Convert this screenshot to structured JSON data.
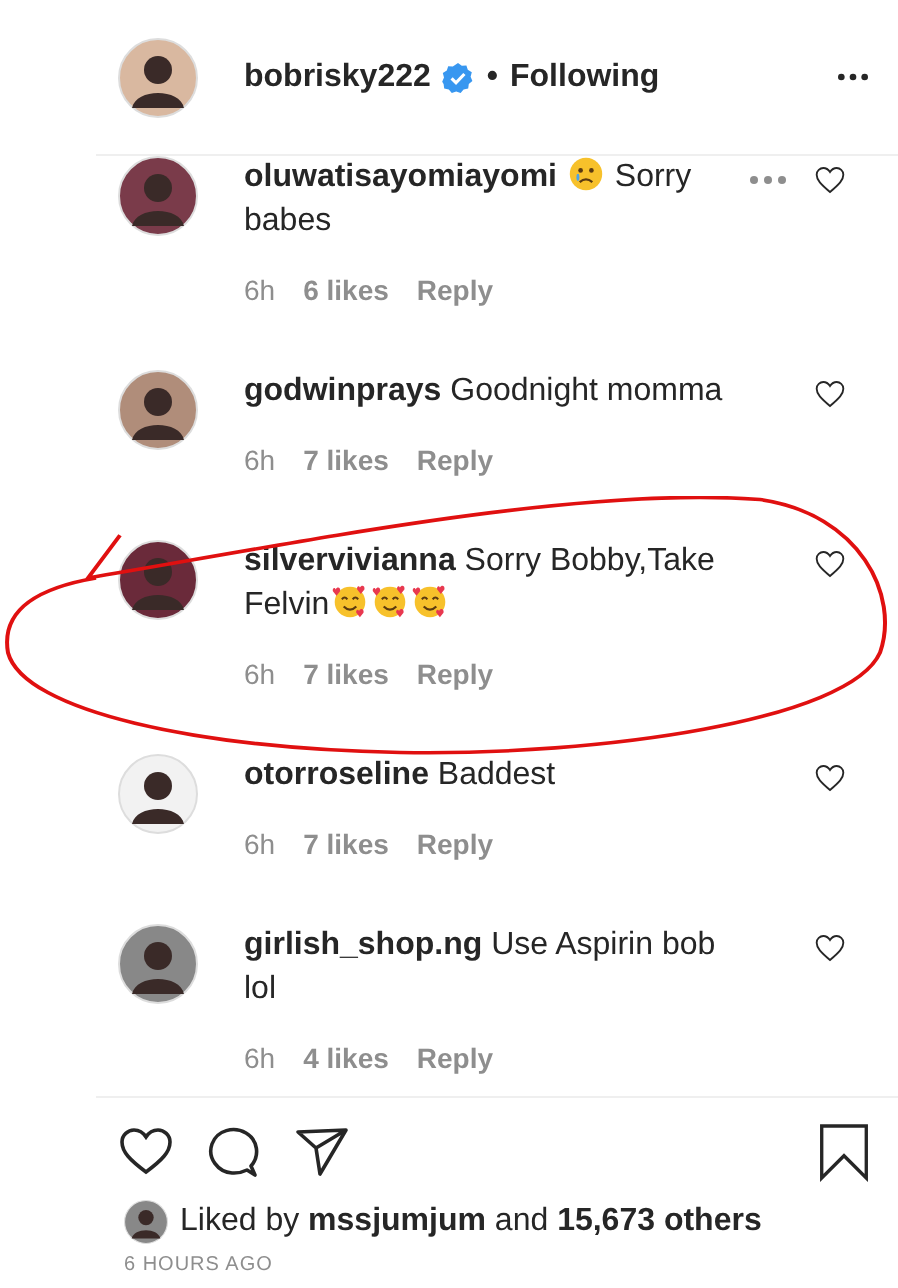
{
  "header": {
    "username": "bobrisky222",
    "verified": true,
    "separator": "•",
    "follow_label": "Following"
  },
  "comments": [
    {
      "username": "oluwatisayomiayomi",
      "parts": [
        {
          "kind": "emoji_sad"
        },
        {
          "kind": "text",
          "text": "Sorry babes"
        }
      ],
      "time": "6h",
      "likes": "6 likes",
      "reply": "Reply",
      "menu": true,
      "circled": false
    },
    {
      "username": "godwinprays",
      "parts": [
        {
          "kind": "text",
          "text": "Goodnight momma"
        }
      ],
      "time": "6h",
      "likes": "7 likes",
      "reply": "Reply",
      "menu": false,
      "circled": false
    },
    {
      "username": "silvervivianna",
      "parts": [
        {
          "kind": "text",
          "text": "Sorry Bobby,Take Felvin"
        },
        {
          "kind": "emoji_love"
        },
        {
          "kind": "emoji_love"
        },
        {
          "kind": "emoji_love"
        }
      ],
      "time": "6h",
      "likes": "7 likes",
      "reply": "Reply",
      "menu": false,
      "circled": true
    },
    {
      "username": "otorroseline",
      "parts": [
        {
          "kind": "text",
          "text": "Baddest"
        }
      ],
      "time": "6h",
      "likes": "7 likes",
      "reply": "Reply",
      "menu": false,
      "circled": false
    },
    {
      "username": "girlish_shop.ng",
      "parts": [
        {
          "kind": "text",
          "text": "Use Aspirin bob lol"
        }
      ],
      "time": "6h",
      "likes": "4 likes",
      "reply": "Reply",
      "menu": false,
      "circled": false
    }
  ],
  "likes_summary": "Liked by **mssjumjum** and **15,673 others**",
  "timestamp": "6 HOURS AGO"
}
